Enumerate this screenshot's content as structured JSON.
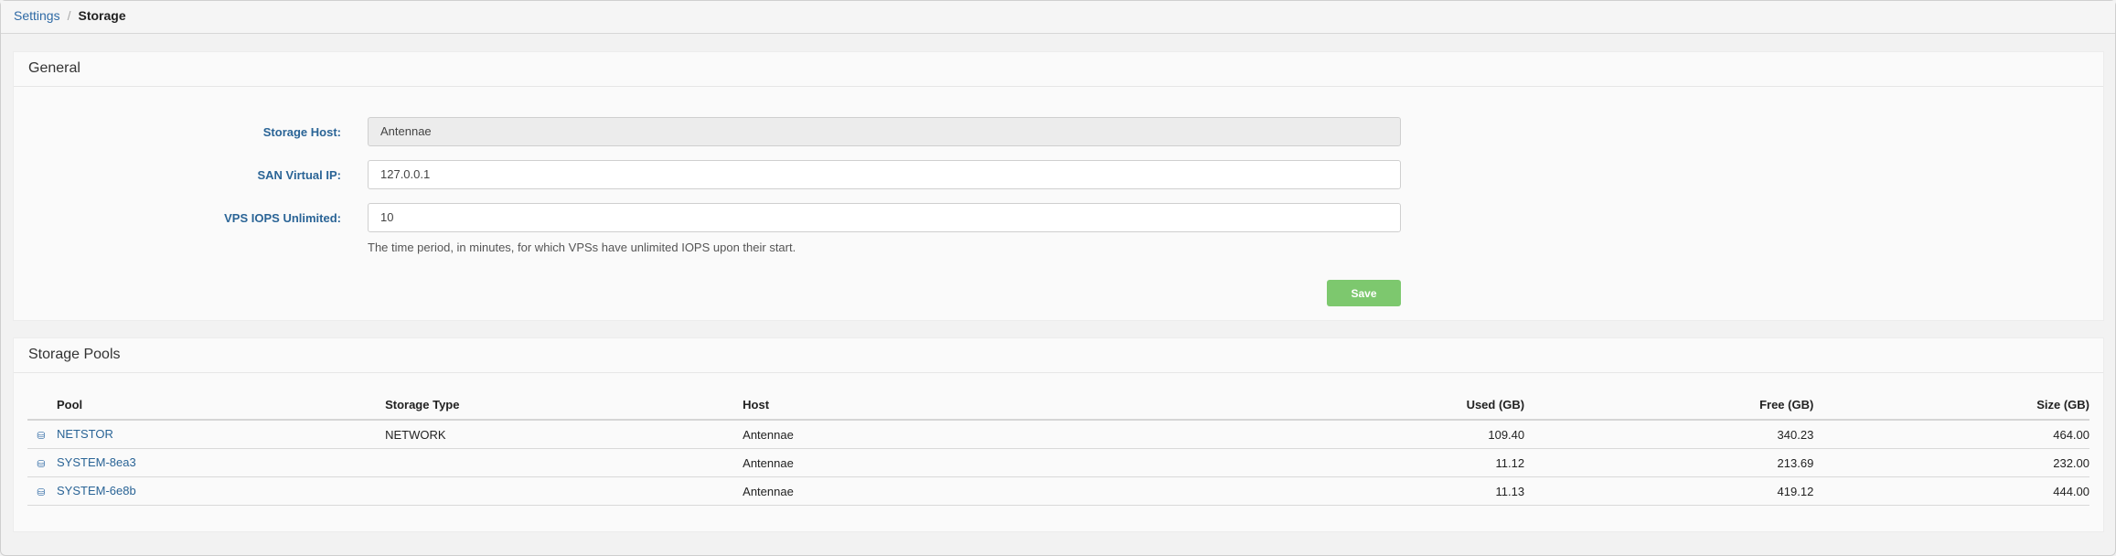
{
  "breadcrumb": {
    "parent": "Settings",
    "separator": "/",
    "current": "Storage"
  },
  "general": {
    "title": "General",
    "fields": [
      {
        "label": "Storage Host:",
        "value": "Antennae"
      },
      {
        "label": "SAN Virtual IP:",
        "value": "127.0.0.1"
      },
      {
        "label": "VPS IOPS Unlimited:",
        "value": "10"
      }
    ],
    "help_text": "The time period, in minutes, for which VPSs have unlimited IOPS upon their start.",
    "save_label": "Save"
  },
  "pools": {
    "title": "Storage Pools",
    "columns": [
      "Pool",
      "Storage Type",
      "Host",
      "Used (GB)",
      "Free (GB)",
      "Size (GB)"
    ],
    "rows": [
      {
        "pool": "NETSTOR",
        "type": "NETWORK",
        "host": "Antennae",
        "used": "109.40",
        "free": "340.23",
        "size": "464.00",
        "icon": "hard-drive-icon"
      },
      {
        "pool": "SYSTEM-8ea3",
        "type": "",
        "host": "Antennae",
        "used": "11.12",
        "free": "213.69",
        "size": "232.00",
        "icon": "hard-drive-icon"
      },
      {
        "pool": "SYSTEM-6e8b",
        "type": "",
        "host": "Antennae",
        "used": "11.13",
        "free": "419.12",
        "size": "444.00",
        "icon": "hard-drive-icon"
      }
    ]
  },
  "colors": {
    "link": "#2a6496",
    "save_button": "#7dc86e",
    "background": "#f2f2f2"
  }
}
